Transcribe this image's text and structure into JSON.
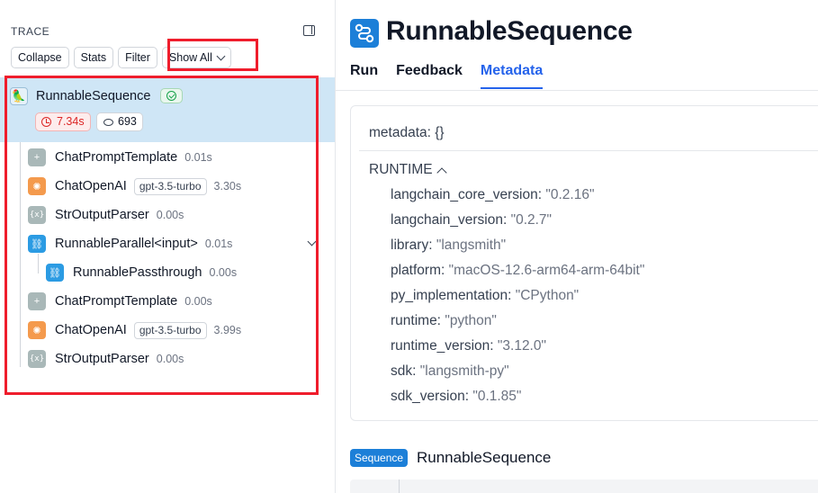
{
  "left_panel": {
    "title": "TRACE",
    "toolbar": {
      "collapse": "Collapse",
      "stats": "Stats",
      "filter": "Filter",
      "show_all": "Show All"
    },
    "root": {
      "name": "RunnableSequence",
      "latency": "7.34s",
      "tokens": "693",
      "status": "success"
    },
    "nodes": [
      {
        "name": "ChatPromptTemplate",
        "icon": "prompt-icon",
        "model": "",
        "time": "0.01s"
      },
      {
        "name": "ChatOpenAI",
        "icon": "openai-icon",
        "model": "gpt-3.5-turbo",
        "time": "3.30s"
      },
      {
        "name": "StrOutputParser",
        "icon": "parser-icon",
        "model": "",
        "time": "0.00s"
      },
      {
        "name": "RunnableParallel<input>",
        "icon": "link-icon",
        "model": "",
        "time": "0.01s"
      },
      {
        "name": "RunnablePassthrough",
        "icon": "link-icon",
        "model": "",
        "time": "0.00s"
      },
      {
        "name": "ChatPromptTemplate",
        "icon": "prompt-icon",
        "model": "",
        "time": "0.00s"
      },
      {
        "name": "ChatOpenAI",
        "icon": "openai-icon",
        "model": "gpt-3.5-turbo",
        "time": "3.99s"
      },
      {
        "name": "StrOutputParser",
        "icon": "parser-icon",
        "model": "",
        "time": "0.00s"
      }
    ]
  },
  "right_panel": {
    "title": "RunnableSequence",
    "tabs": [
      "Run",
      "Feedback",
      "Metadata"
    ],
    "active_tab": "Metadata",
    "metadata_line": {
      "key": "metadata:",
      "value": "{}"
    },
    "runtime_header": "RUNTIME",
    "runtime": [
      {
        "key": "langchain_core_version:",
        "value": "\"0.2.16\""
      },
      {
        "key": "langchain_version:",
        "value": "\"0.2.7\""
      },
      {
        "key": "library:",
        "value": "\"langsmith\""
      },
      {
        "key": "platform:",
        "value": "\"macOS-12.6-arm64-arm-64bit\""
      },
      {
        "key": "py_implementation:",
        "value": "\"CPython\""
      },
      {
        "key": "runtime:",
        "value": "\"python\""
      },
      {
        "key": "runtime_version:",
        "value": "\"3.12.0\""
      },
      {
        "key": "sdk:",
        "value": "\"langsmith-py\""
      },
      {
        "key": "sdk_version:",
        "value": "\"0.1.85\""
      }
    ],
    "section": {
      "badge": "Sequence",
      "name": "RunnableSequence"
    }
  },
  "colors": {
    "selected_row": "#cfe6f6",
    "accent": "#2563eb",
    "highlight_box": "#ef1d2c",
    "error_red": "#dc2626",
    "success_green": "#16a34a"
  }
}
